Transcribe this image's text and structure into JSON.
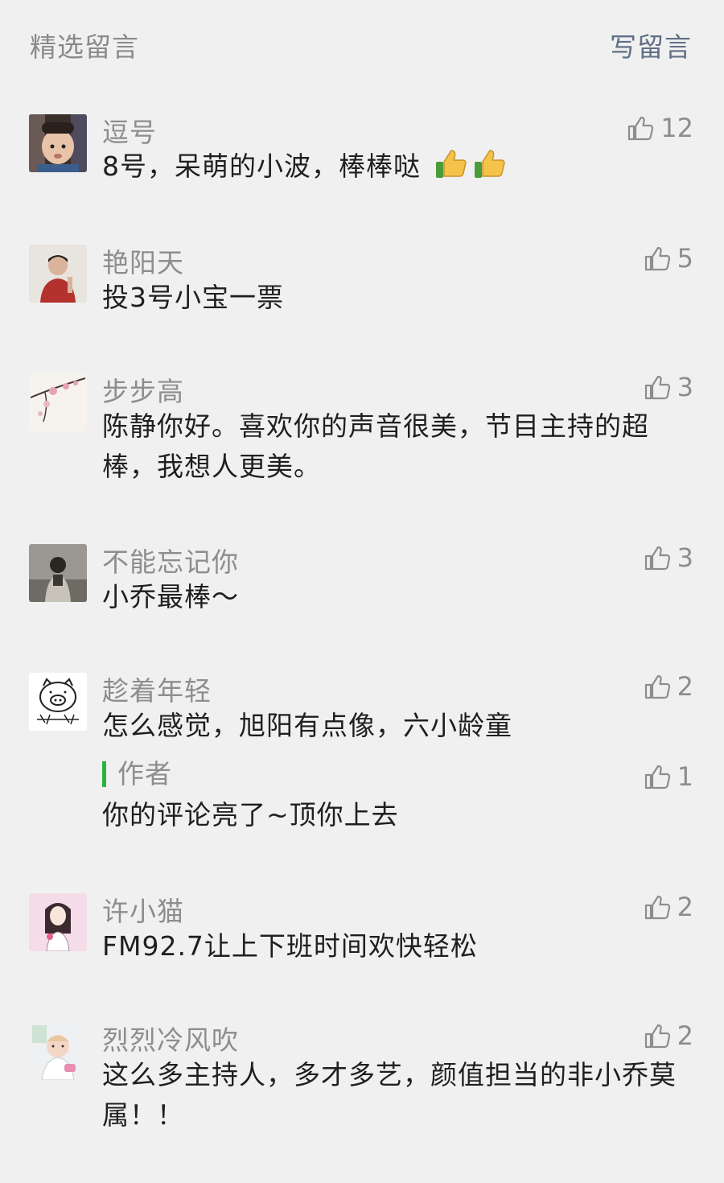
{
  "header": {
    "title": "精选留言",
    "write_label": "写留言"
  },
  "comments": [
    {
      "nickname": "逗号",
      "likes": "12",
      "text": "8号，呆萌的小波，棒棒哒",
      "avatar": "child-photo"
    },
    {
      "nickname": "艳阳天",
      "likes": "5",
      "text": "投3号小宝一票",
      "avatar": "person-photo"
    },
    {
      "nickname": "步步高",
      "likes": "3",
      "text": "陈静你好。喜欢你的声音很美，节目主持的超棒，我想人更美。",
      "avatar": "plum-blossom"
    },
    {
      "nickname": "不能忘记你",
      "likes": "3",
      "text": "小乔最棒～",
      "avatar": "person-photo-dark"
    },
    {
      "nickname": "趁着年轻",
      "likes": "2",
      "text": "怎么感觉，旭阳有点像，六小龄童",
      "avatar": "pig-sketch"
    },
    {
      "nickname": "许小猫",
      "likes": "2",
      "text": "FM92.7让上下班时间欢快轻松",
      "avatar": "anime-girl"
    },
    {
      "nickname": "烈烈冷风吹",
      "likes": "2",
      "text": "这么多主持人，多才多艺，颜值担当的非小乔莫属！！",
      "avatar": "baby-photo"
    }
  ],
  "reply": {
    "label": "作者",
    "likes": "1",
    "text": "你的评论亮了~顶你上去"
  },
  "colors": {
    "background": "#f0f0f0",
    "link": "#5f6f86",
    "author_bar": "#2bb240",
    "muted": "#8d8d8d"
  },
  "icons": {
    "like": "thumbs-up-icon",
    "emoji": "thumbs-up-emoji"
  }
}
